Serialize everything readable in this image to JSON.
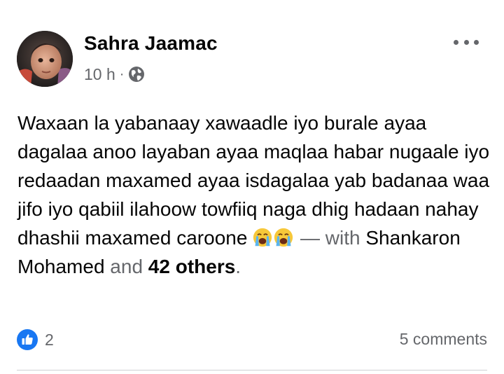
{
  "post": {
    "author": "Sahra Jaamac",
    "time": "10 h",
    "separator": "·",
    "privacy_icon": "globe-icon",
    "more_icon": "more-dots-icon",
    "text": "Waxaan la yabanaay xawaadle iyo burale ayaa dagalaa anoo layaban ayaa maqlaa habar nugaale iyo redaadan maxamed ayaa isdagalaa yab badanaa waa jifo iyo qabiil ilahoow towfiiq naga dhig hadaan nahay dhashii maxamed caroone",
    "emojis": [
      "crying-face-emoji",
      "crying-face-emoji"
    ],
    "tag_separator": "—",
    "tag_with": "with",
    "tag_person": "Shankaron Mohamed",
    "tag_and": "and",
    "tag_others": "42 others",
    "tag_period": "."
  },
  "footer": {
    "reaction_icon": "like-icon",
    "reaction_count": "2",
    "comments": "5 comments"
  },
  "colors": {
    "text_primary": "#050505",
    "text_secondary": "#65676b",
    "like_blue": "#1877f2",
    "divider": "#ced0d4"
  }
}
